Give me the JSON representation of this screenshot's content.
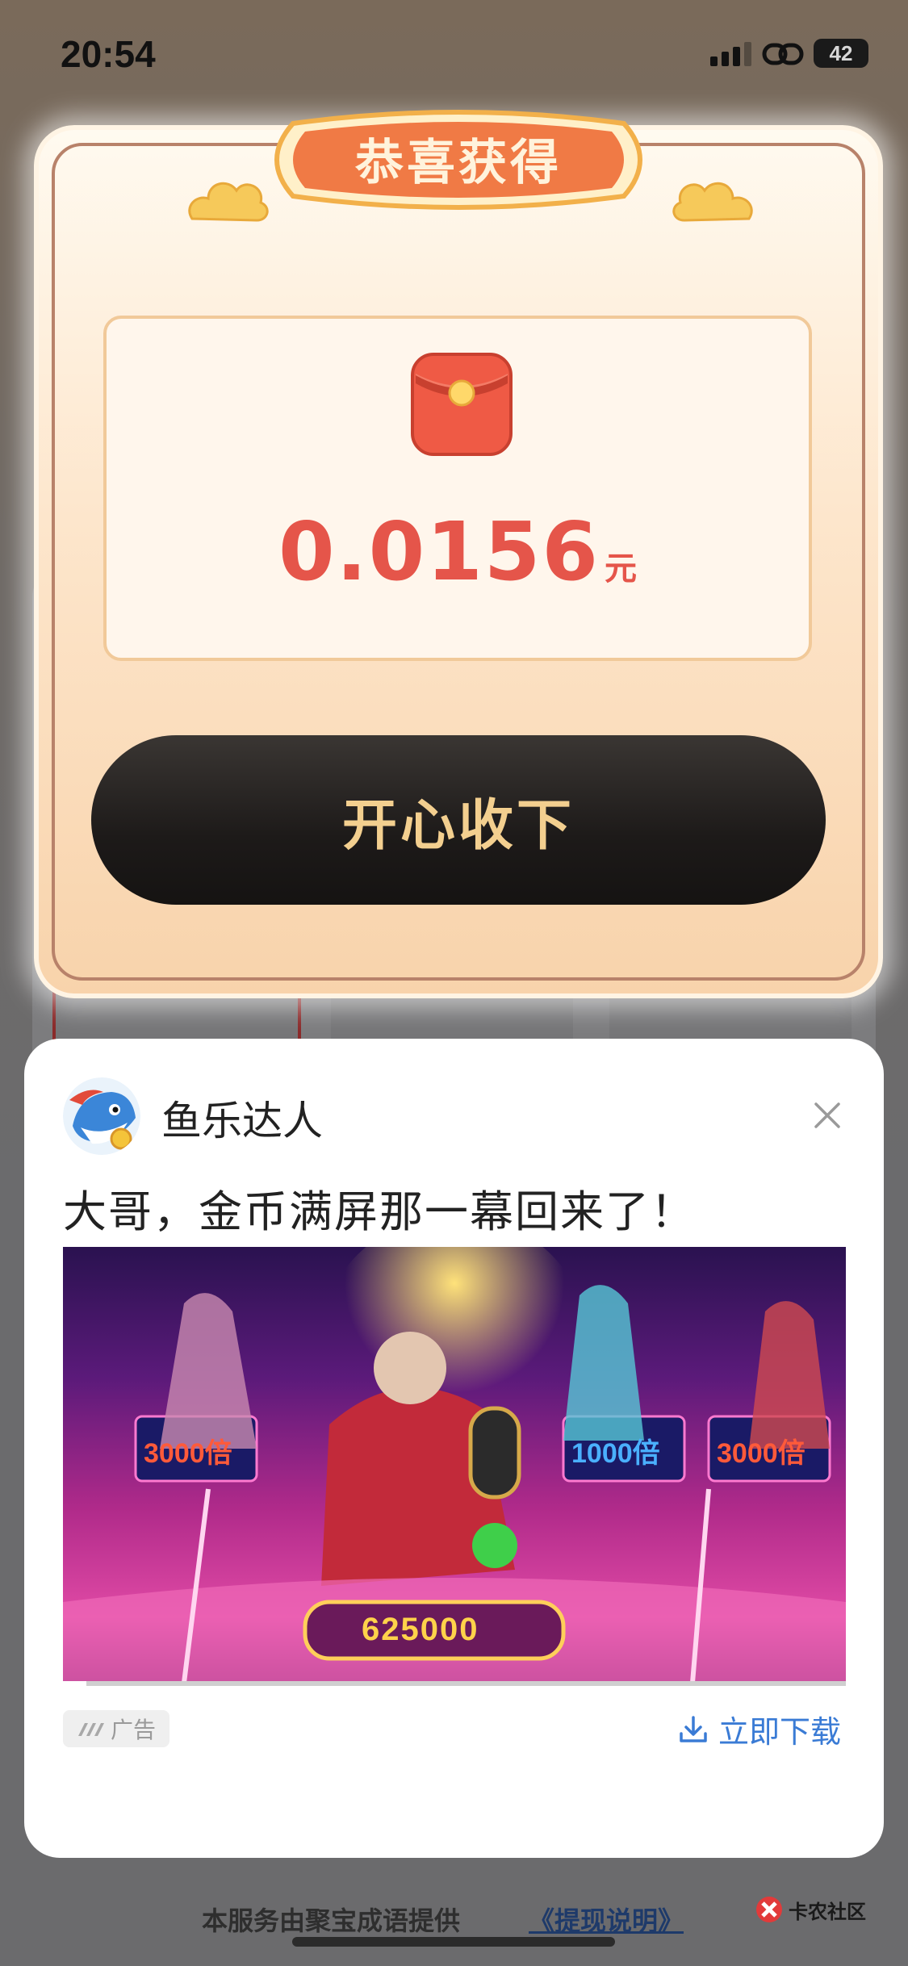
{
  "status_bar": {
    "time": "20:54",
    "battery": "42"
  },
  "reward_modal": {
    "title": "恭喜获得",
    "amount": "0.0156",
    "unit": "元",
    "accept_label": "开心收下"
  },
  "ad": {
    "advertiser": "鱼乐达人",
    "headline": "大哥，金币满屏那一幕回来了！",
    "badge": "广告",
    "download_label": "立即下载",
    "video_progress": 0.03,
    "media_texts": [
      "3000倍",
      "1000倍",
      "3000倍",
      "625000"
    ]
  },
  "footer": {
    "service_text": "本服务由聚宝成语提供",
    "link_text": "《提现说明》",
    "watermark": "卡农社区"
  },
  "colors": {
    "amount_red": "#e5554a",
    "button_gold": "#f3cf8f",
    "download_blue": "#3a7bd5",
    "banner_orange": "#f07a45"
  }
}
